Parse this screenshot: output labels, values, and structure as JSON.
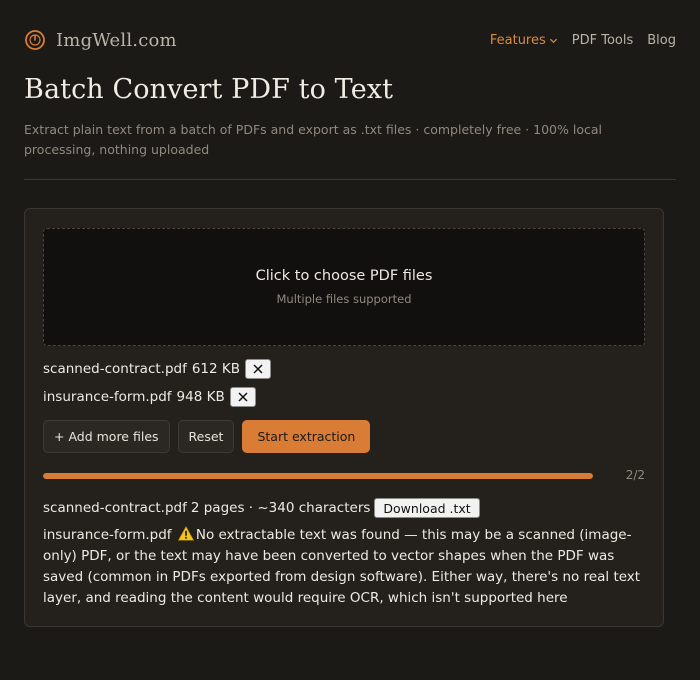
{
  "brand": {
    "name": "ImgWell.com",
    "logo_icon": "clock-icon",
    "accent": "#d97c35"
  },
  "nav": {
    "features": "Features",
    "pdf_tools": "PDF Tools",
    "blog": "Blog"
  },
  "page": {
    "title": "Batch Convert PDF to Text",
    "subtitle": "Extract plain text from a batch of PDFs and export as .txt files · completely free · 100% local processing, nothing uploaded"
  },
  "dropzone": {
    "title": "Click to choose PDF files",
    "subtitle": "Multiple files supported"
  },
  "files": [
    {
      "name": "scanned-contract.pdf",
      "size": "612 KB"
    },
    {
      "name": "insurance-form.pdf",
      "size": "948 KB"
    }
  ],
  "actions": {
    "add_more": "+ Add more files",
    "reset": "Reset",
    "start": "Start extraction"
  },
  "progress": {
    "text": "2/2",
    "fraction": 1.0
  },
  "results": [
    {
      "name": "scanned-contract.pdf",
      "info": "2 pages · ~340 characters",
      "download_label": "Download .txt"
    },
    {
      "name": "insurance-form.pdf",
      "status_icon": "warning-icon",
      "message": "No extractable text was found — this may be a scanned (image-only) PDF, or the text may have been converted to vector shapes when the PDF was saved (common in PDFs exported from design software). Either way, there's no real text layer, and reading the content would require OCR, which isn't supported here"
    }
  ]
}
